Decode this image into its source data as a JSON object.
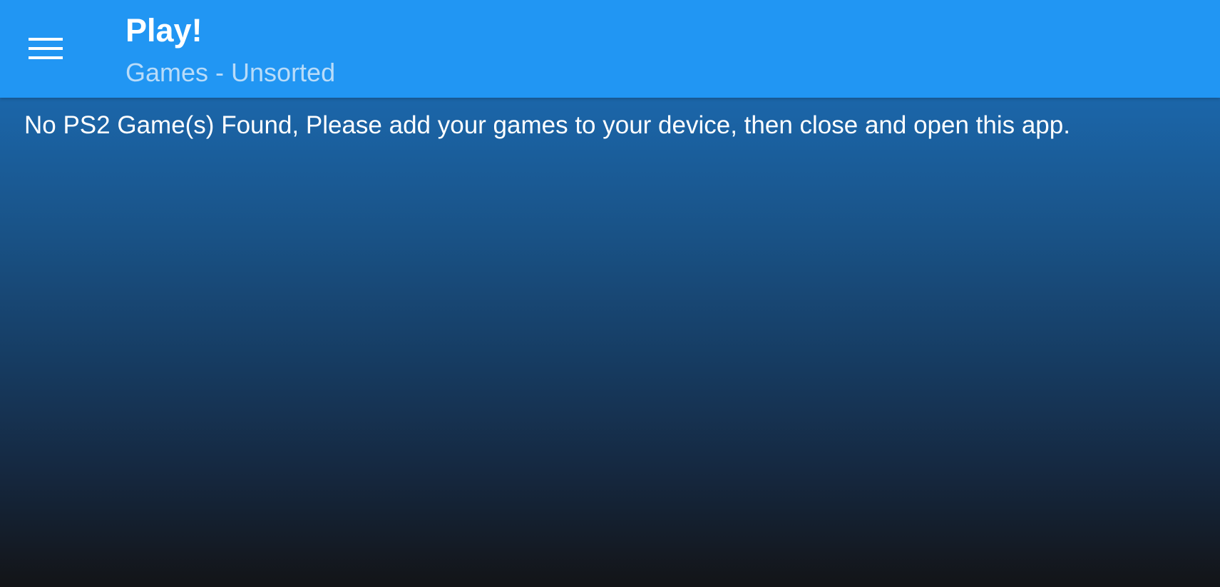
{
  "app_bar": {
    "title": "Play!",
    "subtitle": "Games - Unsorted",
    "menu_icon": "hamburger-menu-icon",
    "background_color": "#2196f3"
  },
  "content": {
    "empty_message": "No PS2 Game(s) Found, Please add your games to your device, then close and open this app."
  }
}
